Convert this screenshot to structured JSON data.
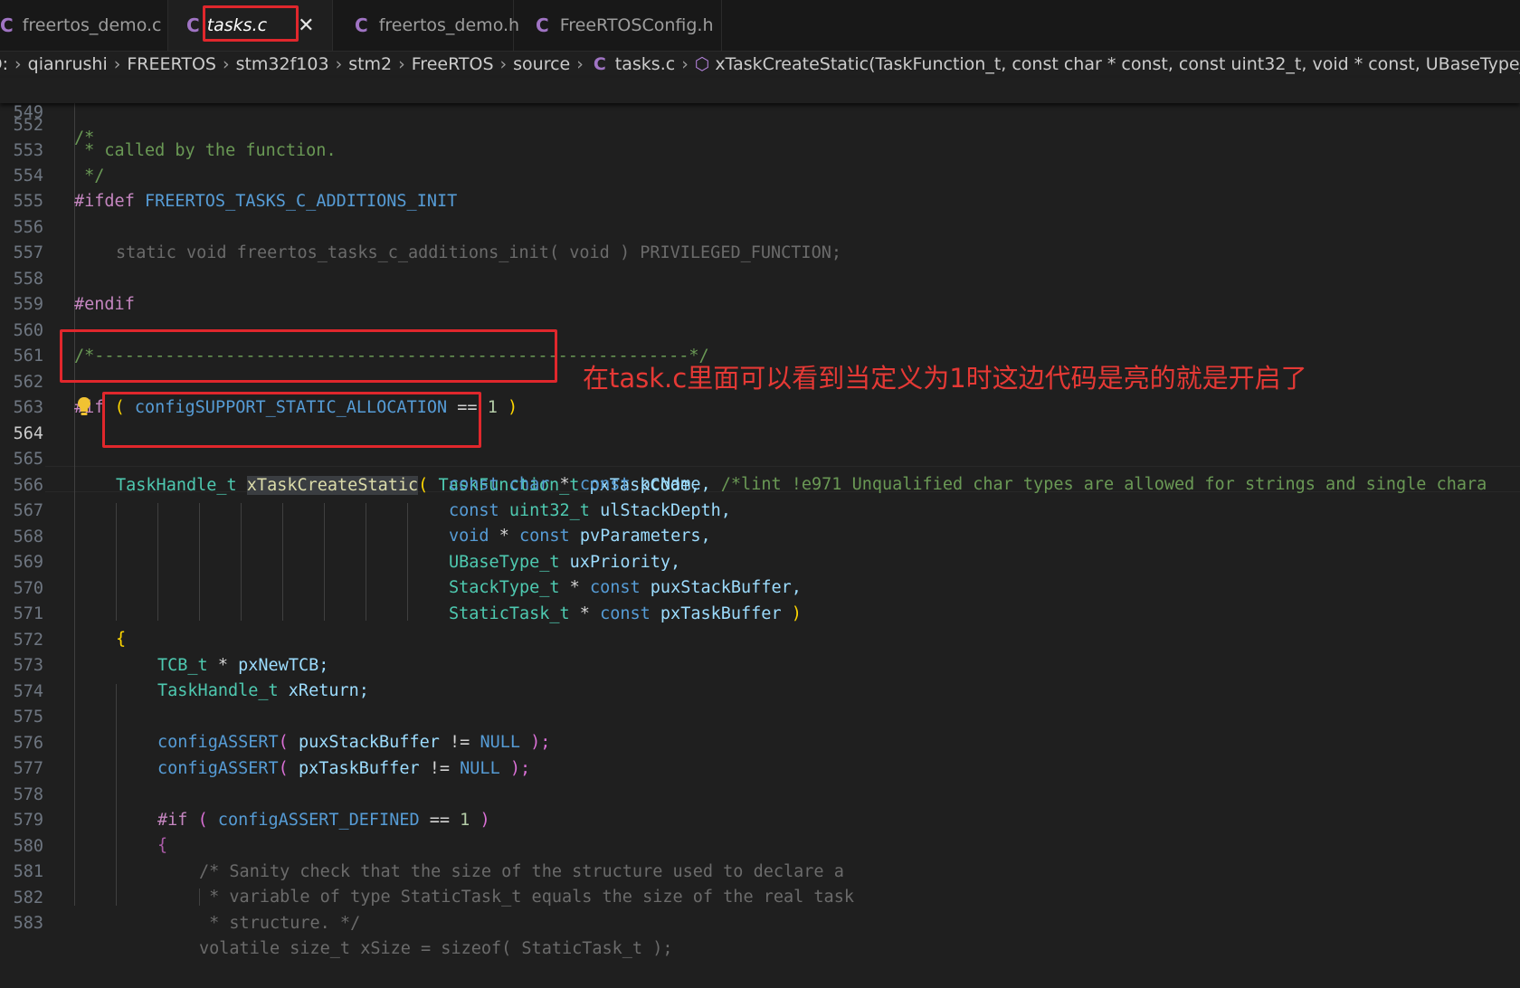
{
  "tabs": [
    {
      "label": "freertos_demo.c",
      "icon": "c-file-icon"
    },
    {
      "label": "tasks.c",
      "icon": "c-file-icon",
      "active": true
    },
    {
      "label": "freertos_demo.h",
      "icon": "c-file-icon"
    },
    {
      "label": "FreeRTOSConfig.h",
      "icon": "c-file-icon"
    }
  ],
  "breadcrumb": {
    "items": [
      "D:",
      "qianrushi",
      "FREERTOS",
      "stm32f103",
      "stm2",
      "FreeRTOS",
      "source"
    ],
    "file": "tasks.c",
    "symbol": "xTaskCreateStatic(TaskFunction_t, const char * const, const uint32_t, void * const, UBaseType_t, StackType_t *"
  },
  "editor": {
    "sticky_line_number": "549",
    "sticky_text": "/*",
    "partial_line_number": "552",
    "partial_text": " * called by the function.",
    "line_numbers": [
      "553",
      "554",
      "555",
      "556",
      "557",
      "558",
      "559",
      "560",
      "561",
      "562",
      "563",
      "564",
      "565",
      "566",
      "567",
      "568",
      "569",
      "570",
      "571",
      "572",
      "573",
      "574",
      "575",
      "576",
      "577",
      "578",
      "579",
      "580",
      "581",
      "582",
      "583"
    ],
    "current_line": "564"
  },
  "code": {
    "l553": " */",
    "l554a": "#ifdef",
    "l554b": "FREERTOS_TASKS_C_ADDITIONS_INIT",
    "l556a": "static",
    "l556b": "void",
    "l556c": "freertos_tasks_c_additions_init",
    "l556d": "(",
    "l556e": "void",
    "l556f": ")",
    "l556g": "PRIVILEGED_FUNCTION;",
    "l558": "#endif",
    "l560": "/*-----------------------------------------------------------*/",
    "l562a": "#if",
    "l562b": "(",
    "l562c": "configSUPPORT_STATIC_ALLOCATION",
    "l562d": "==",
    "l562e": "1",
    "l562f": ")",
    "l564a": "TaskHandle_t",
    "l564b": "xTaskCreateStatic",
    "l564c": "(",
    "l564d": "TaskFunction_t",
    "l564e": "pxTaskCode,",
    "l565a": "const",
    "l565b": "char",
    "l565c": "*",
    "l565d": "const",
    "l565e": "pcName,",
    "l565f": "/*lint !e971 Unqualified char types are allowed for strings and single chara",
    "l566a": "const",
    "l566b": "uint32_t",
    "l566c": "ulStackDepth,",
    "l567a": "void",
    "l567b": "*",
    "l567c": "const",
    "l567d": "pvParameters,",
    "l568a": "UBaseType_t",
    "l568b": "uxPriority,",
    "l569a": "StackType_t",
    "l569b": "*",
    "l569c": "const",
    "l569d": "puxStackBuffer,",
    "l570a": "StaticTask_t",
    "l570b": "*",
    "l570c": "const",
    "l570d": "pxTaskBuffer",
    "l570e": ")",
    "l571": "{",
    "l572a": "TCB_t",
    "l572b": "*",
    "l572c": "pxNewTCB;",
    "l573a": "TaskHandle_t",
    "l573b": "xReturn;",
    "l575a": "configASSERT",
    "l575b": "(",
    "l575c": "puxStackBuffer",
    "l575d": "!=",
    "l575e": "NULL",
    "l575f": ");",
    "l576a": "configASSERT",
    "l576b": "(",
    "l576c": "pxTaskBuffer",
    "l576d": "!=",
    "l576e": "NULL",
    "l576f": ");",
    "l578a": "#if",
    "l578b": "(",
    "l578c": "configASSERT_DEFINED",
    "l578d": "==",
    "l578e": "1",
    "l578f": ")",
    "l579": "{",
    "l580": "/* Sanity check that the size of the structure used to declare a",
    "l581": " * variable of type StaticTask_t equals the size of the real task",
    "l582": " * structure. */",
    "l583": "volatile size_t xSize = sizeof( StaticTask_t );"
  },
  "annotation": {
    "text": "在task.c里面可以看到当定义为1时这边代码是亮的就是开启了",
    "color": "#e53935"
  },
  "colors": {
    "background": "#1f1f1f",
    "highlight_box": "#e0272c"
  }
}
